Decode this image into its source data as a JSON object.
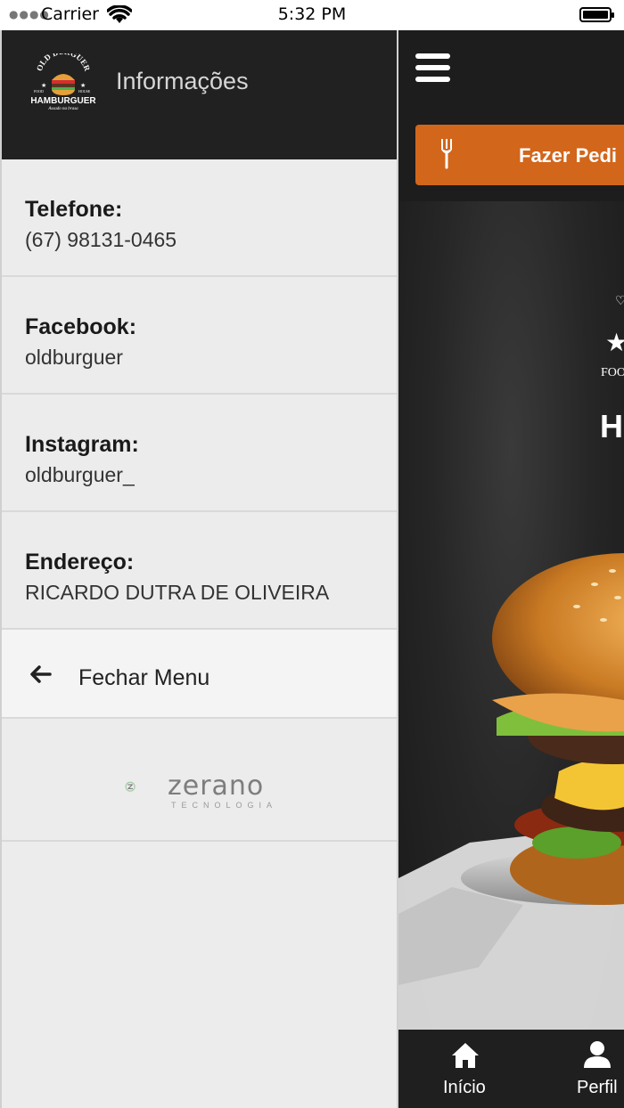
{
  "status_bar": {
    "carrier": "Carrier",
    "time": "5:32 PM"
  },
  "drawer": {
    "title": "Informações",
    "logo": {
      "arc_text": "OLD BURGUER",
      "left_text": "FOOD",
      "right_text": "HOUSE",
      "main_text": "HAMBURGUER",
      "script_text": "Assado na brasa"
    },
    "items": [
      {
        "label": "Telefone:",
        "value": "(67) 98131-0465"
      },
      {
        "label": "Facebook:",
        "value": "oldburguer"
      },
      {
        "label": "Instagram:",
        "value": "oldburguer_"
      },
      {
        "label": "Endereço:",
        "value": "RICARDO DUTRA DE OLIVEIRA"
      }
    ],
    "close_label": "Fechar Menu",
    "brand": {
      "name": "zerano",
      "subtitle": "TECNOLOGIA"
    }
  },
  "main": {
    "order_button": "Fazer Pedi",
    "hero_text_partial": [
      "FOO",
      "H"
    ],
    "nav": [
      {
        "label": "Início",
        "icon": "home-icon"
      },
      {
        "label": "Perfil",
        "icon": "user-icon"
      }
    ]
  },
  "colors": {
    "accent": "#d2661b",
    "header_bg": "#212121",
    "drawer_bg": "#ececec"
  }
}
